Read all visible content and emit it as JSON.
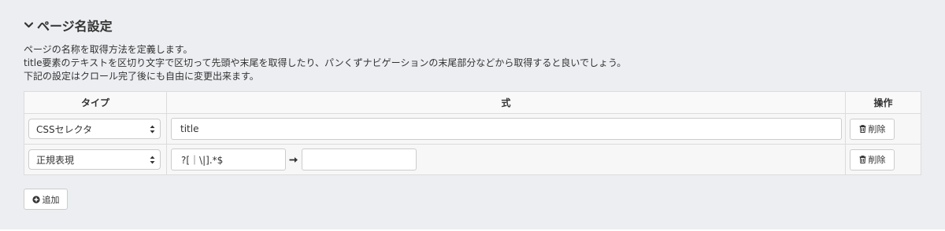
{
  "section": {
    "title": "ページ名設定",
    "icon": "chevron-down-icon"
  },
  "description": {
    "line1": "ページの名称を取得方法を定義します。",
    "line2": "title要素のテキストを区切り文字で区切って先頭や末尾を取得したり、パンくずナビゲーションの末尾部分などから取得すると良いでしょう。",
    "line3": "下記の設定はクロール完了後にも自由に変更出来ます。"
  },
  "table": {
    "headers": {
      "type": "タイプ",
      "expression": "式",
      "operation": "操作"
    },
    "rows": [
      {
        "type": "CSSセレクタ",
        "expression": "title",
        "delete_label": "削除"
      },
      {
        "type": "正規表現",
        "pattern": "?[｜\\|].*$",
        "replacement": "",
        "delete_label": "削除"
      }
    ]
  },
  "add_button": {
    "label": "追加"
  },
  "colors": {
    "background": "#eceef1",
    "border": "#dcdcdc"
  }
}
